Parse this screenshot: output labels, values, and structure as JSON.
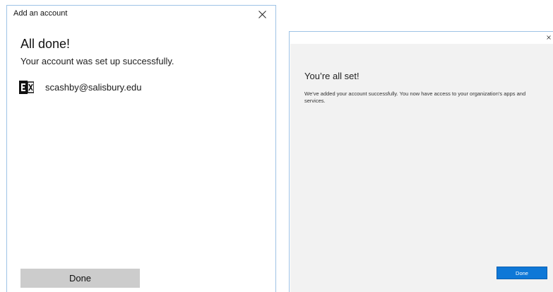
{
  "left_dialog": {
    "title": "Add an account",
    "heading": "All done!",
    "subtext": "Your account was set up successfully.",
    "account": {
      "email": "scashby@salisbury.edu",
      "icon": "exchange-logo-icon"
    },
    "done_label": "Done",
    "close_icon": "close-icon"
  },
  "right_dialog": {
    "heading": "You’re all set!",
    "message": "We’ve added your account successfully. You now have access to your organization’s apps and services.",
    "done_label": "Done",
    "close_icon": "close-icon"
  },
  "colors": {
    "accent_blue": "#0f78d7",
    "border_blue": "#9ec3e6",
    "left_button_gray": "#cccccc",
    "right_panel_bg": "#f2f2f2",
    "exchange_black": "#111111"
  }
}
